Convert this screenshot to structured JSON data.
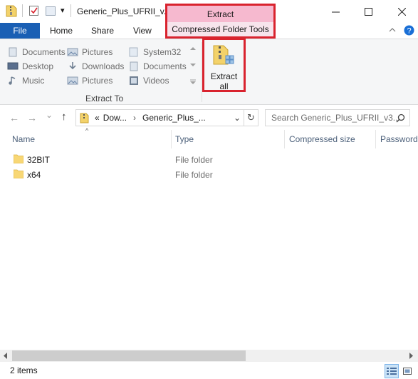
{
  "titlebar": {
    "title": "Generic_Plus_UFRII_v...",
    "qa_dropdown_glyph": "▾",
    "minimize_glyph": "—",
    "maximize_glyph": "☐",
    "close_glyph": "✕"
  },
  "context_tab": {
    "header": "Extract",
    "label": "Compressed Folder Tools",
    "highlight_color": "#d9232e"
  },
  "tabs": {
    "file": "File",
    "home": "Home",
    "share": "Share",
    "view": "View"
  },
  "ribbon": {
    "gallery": [
      {
        "label": "Documents",
        "icon": "documents-icon"
      },
      {
        "label": "Pictures",
        "icon": "pictures-icon"
      },
      {
        "label": "System32",
        "icon": "folder-icon"
      },
      {
        "label": "Desktop",
        "icon": "desktop-icon"
      },
      {
        "label": "Downloads",
        "icon": "downloads-icon"
      },
      {
        "label": "Documents",
        "icon": "documents-icon"
      },
      {
        "label": "Music",
        "icon": "music-icon"
      },
      {
        "label": "Pictures",
        "icon": "pictures-icon"
      },
      {
        "label": "Videos",
        "icon": "videos-icon"
      }
    ],
    "group_label": "Extract To",
    "extract_all_line1": "Extract",
    "extract_all_line2": "all"
  },
  "nav": {
    "back_glyph": "←",
    "forward_glyph": "→",
    "dropdown_glyph": "⌄",
    "up_glyph": "↑",
    "breadcrumb_prefix": "«",
    "breadcrumb_1": "Dow...",
    "breadcrumb_sep": "›",
    "breadcrumb_2": "Generic_Plus_...",
    "refresh_glyph": "↻",
    "search_placeholder": "Search Generic_Plus_UFRII_v3...."
  },
  "columns": {
    "name": "Name",
    "type": "Type",
    "compressed_size": "Compressed size",
    "password": "Password"
  },
  "rows": [
    {
      "name": "32BIT",
      "type": "File folder"
    },
    {
      "name": "x64",
      "type": "File folder"
    }
  ],
  "status": {
    "item_count": "2 items"
  },
  "colors": {
    "file_tab": "#1a5fb4",
    "context_header": "#f6b9cf",
    "context_label_bg": "#f7e4ec",
    "folder_yellow": "#f8d775"
  }
}
